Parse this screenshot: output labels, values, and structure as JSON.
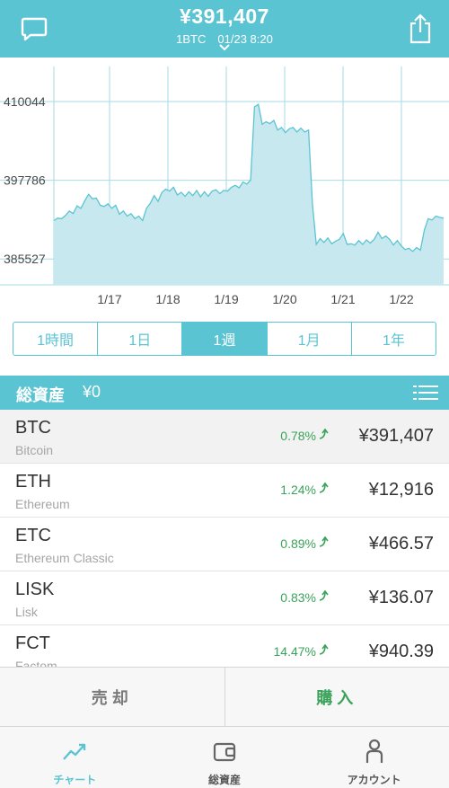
{
  "header": {
    "price": "¥391,407",
    "subtitle": "1BTC　01/23 8:20",
    "accent": "#5bc4d3"
  },
  "chart_data": {
    "type": "area",
    "x_ticks": [
      "1/17",
      "1/18",
      "1/19",
      "1/20",
      "1/21",
      "1/22"
    ],
    "y_ticks": [
      "410044",
      "397786",
      "385527"
    ],
    "ylim": [
      381500,
      415500
    ],
    "color": "#5bc4d3",
    "series": [
      {
        "values": [
          391500,
          391900,
          391800,
          392300,
          393000,
          392600,
          393800,
          393400,
          394600,
          395600,
          394900,
          395000,
          393900,
          393700,
          394100,
          393400,
          393900,
          392500,
          393000,
          392200,
          392600,
          391800,
          392200,
          391500,
          393400,
          394200,
          395400,
          394500,
          395900,
          396400,
          396100,
          396700,
          395500,
          395900,
          395300,
          396000,
          395400,
          396200,
          395200,
          396000,
          395300,
          396100,
          396300,
          395700,
          396200,
          396100,
          396700,
          397000,
          396600,
          397500,
          397200,
          397800,
          409200,
          409600,
          406500,
          406900,
          406600,
          407100,
          405600,
          406000,
          405200,
          405800,
          406000,
          405300,
          405900,
          405300,
          405600,
          394100,
          387800,
          388700,
          388100,
          388800,
          387900,
          388300,
          388600,
          389500,
          387800,
          387900,
          387700,
          388400,
          387800,
          388500,
          388000,
          388600,
          389700,
          388700,
          389100,
          388600,
          387700,
          388400,
          387600,
          387000,
          387200,
          386700,
          387300,
          386900,
          390000,
          391800,
          391600,
          392200,
          392000,
          391900
        ]
      }
    ]
  },
  "tabs": {
    "items": [
      {
        "label": "1時間"
      },
      {
        "label": "1日"
      },
      {
        "label": "1週"
      },
      {
        "label": "1月"
      },
      {
        "label": "1年"
      }
    ],
    "active_index": 2
  },
  "assets": {
    "title": "総資産",
    "amount": "¥0"
  },
  "coins": [
    {
      "symbol": "BTC",
      "name": "Bitcoin",
      "change": "0.78%",
      "price": "¥391,407"
    },
    {
      "symbol": "ETH",
      "name": "Ethereum",
      "change": "1.24%",
      "price": "¥12,916"
    },
    {
      "symbol": "ETC",
      "name": "Ethereum Classic",
      "change": "0.89%",
      "price": "¥466.57"
    },
    {
      "symbol": "LISK",
      "name": "Lisk",
      "change": "0.83%",
      "price": "¥136.07"
    },
    {
      "symbol": "FCT",
      "name": "Factom",
      "change": "14.47%",
      "price": "¥940.39"
    }
  ],
  "actions": {
    "sell": "売却",
    "buy": "購入",
    "buy_color": "#3aa35a"
  },
  "nav": {
    "chart": "チャート",
    "assets": "総資産",
    "account": "アカウント"
  }
}
